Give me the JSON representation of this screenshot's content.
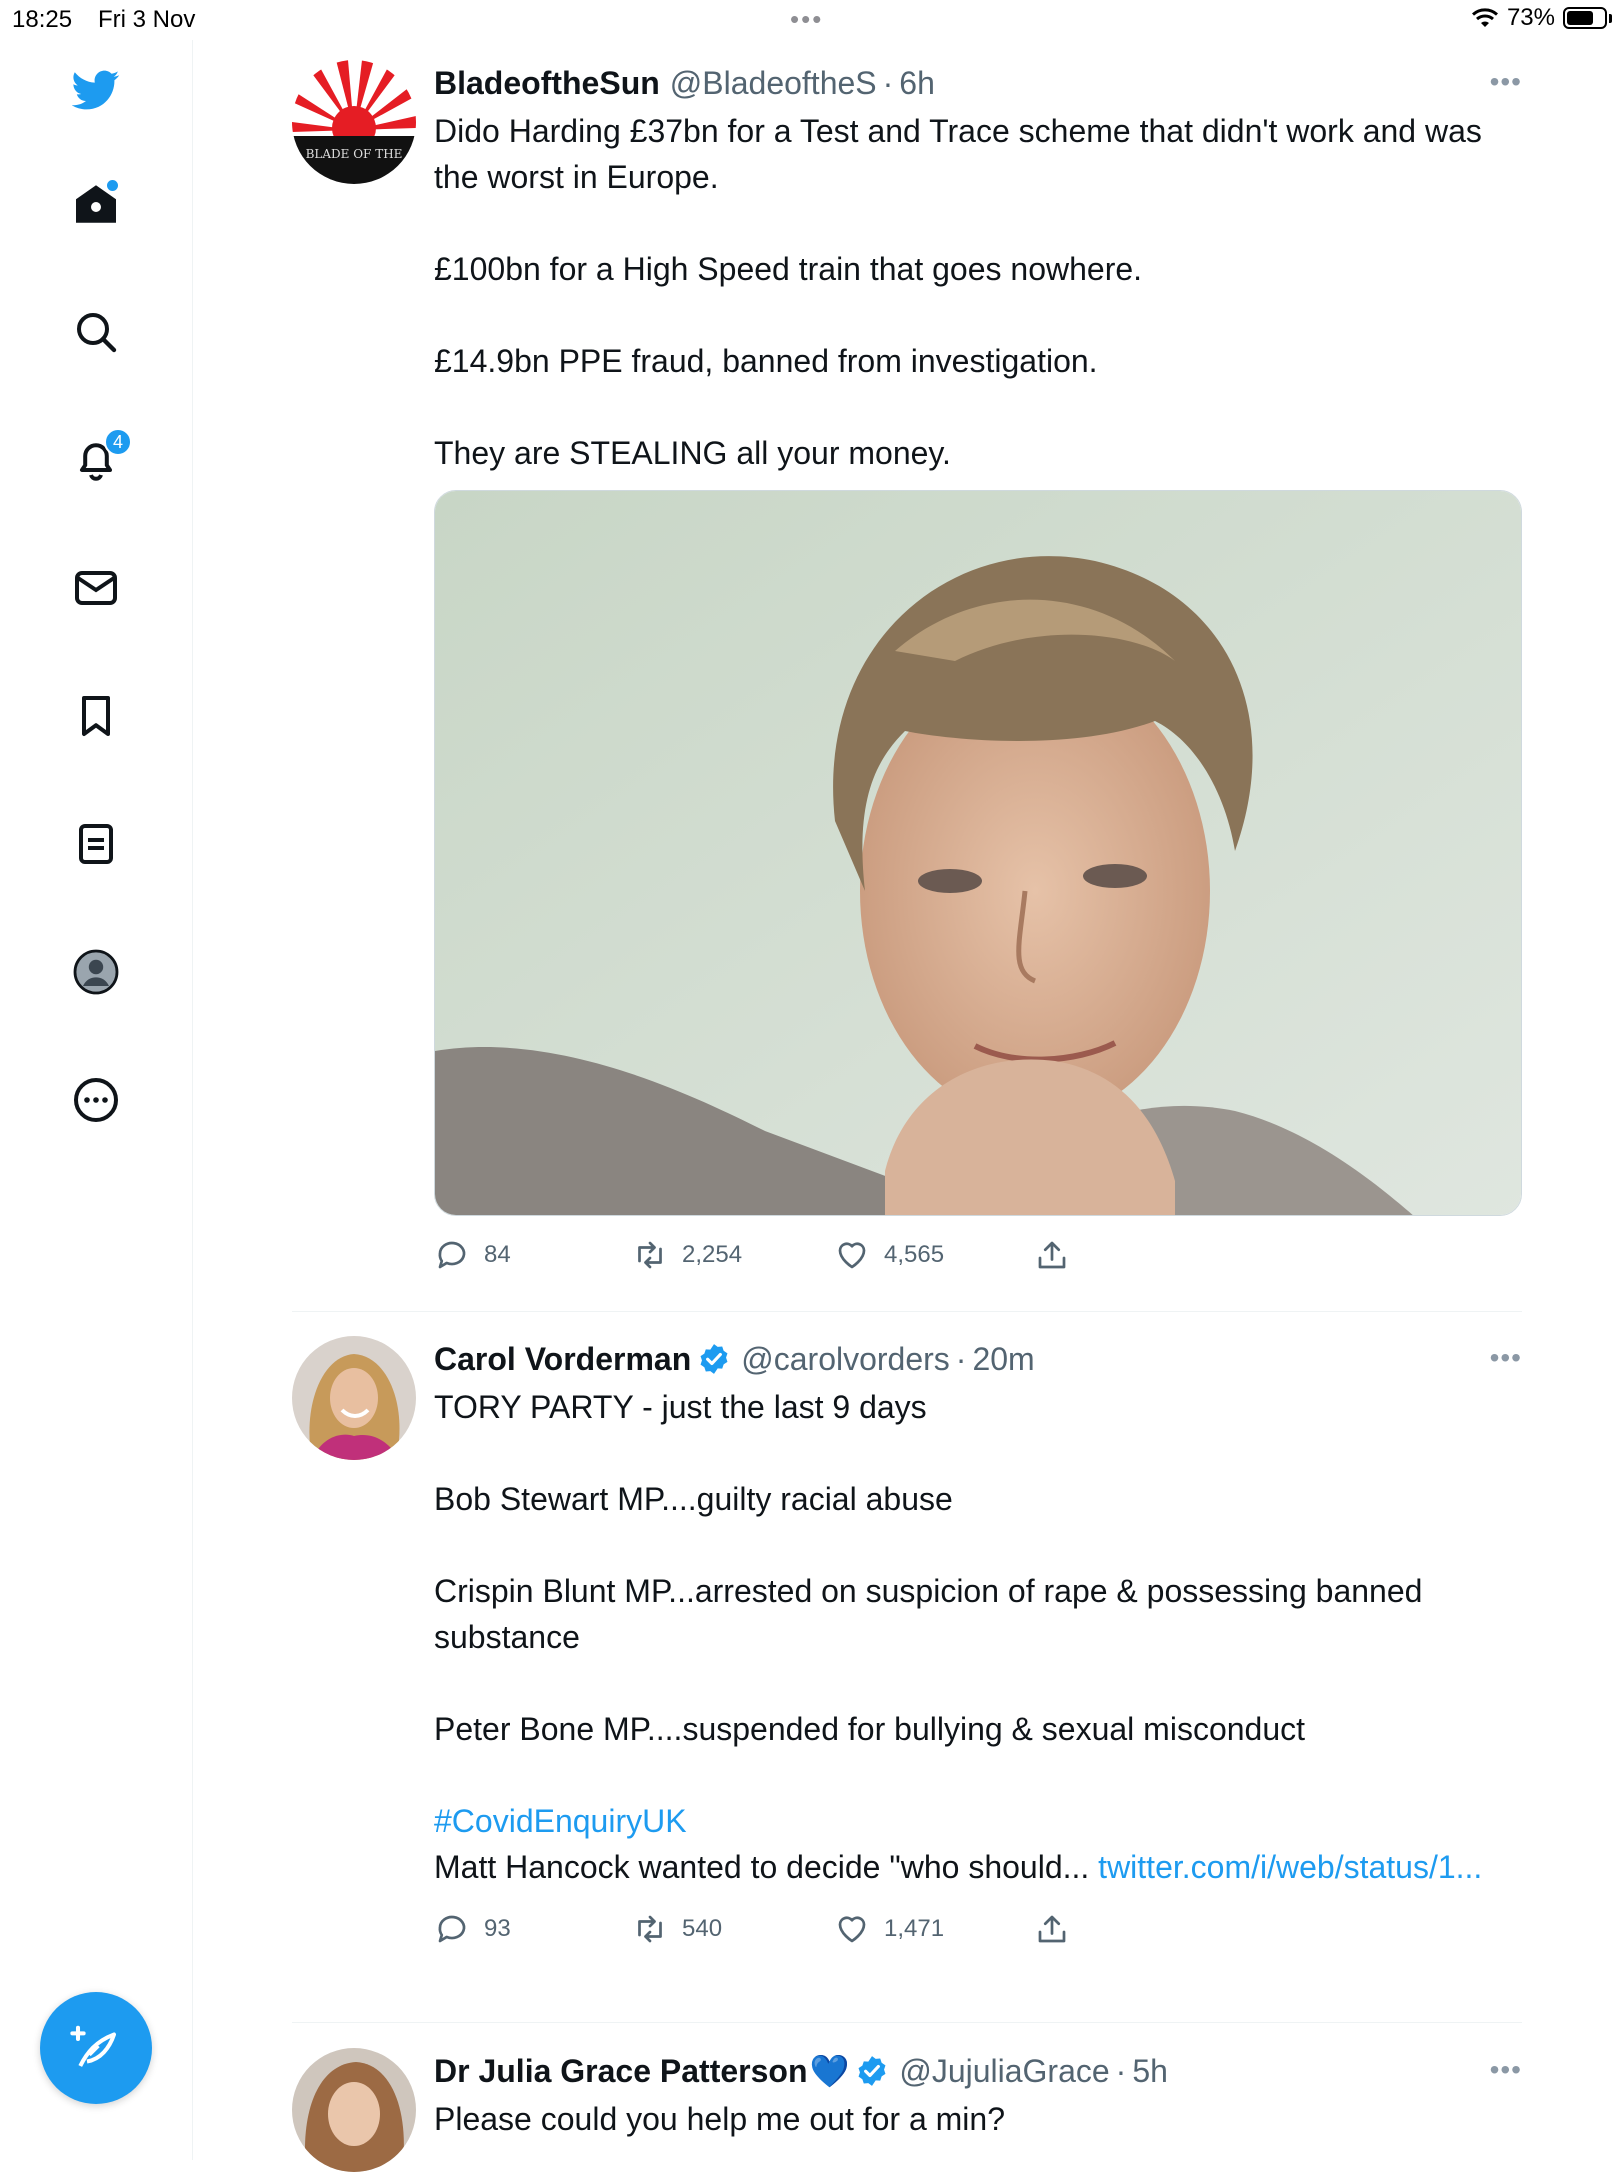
{
  "status_bar": {
    "time": "18:25",
    "date": "Fri 3 Nov",
    "battery": "73%",
    "battery_level": 0.73
  },
  "sidebar": {
    "notifications_badge": "4",
    "items": [
      "twitter-logo",
      "home-icon",
      "search-icon",
      "notifications-icon",
      "messages-icon",
      "bookmarks-icon",
      "lists-icon",
      "profile-icon",
      "more-icon"
    ]
  },
  "tweets": [
    {
      "name": "BladeoftheSun",
      "handle": "@BladeoftheS",
      "time": "6h",
      "avatar_text": "BLADE OF THE",
      "paragraphs": [
        "Dido Harding £37bn for a Test and Trace scheme that didn't work and was the worst in Europe.",
        "£100bn for a High Speed train that goes nowhere.",
        "£14.9bn PPE fraud, banned from investigation.",
        "They are STEALING all your money."
      ],
      "replies": "84",
      "retweets": "2,254",
      "likes": "4,565"
    },
    {
      "name": "Carol Vorderman",
      "handle": "@carolvorders",
      "time": "20m",
      "paragraphs": [
        "TORY PARTY - just the last 9 days",
        "Bob Stewart MP....guilty racial abuse",
        "Crispin Blunt MP...arrested on suspicion of rape & possessing banned substance",
        "Peter Bone MP....suspended for bullying & sexual misconduct"
      ],
      "hashtag": "#CovidEnquiryUK",
      "last_text": "Matt Hancock wanted to decide \"who should... ",
      "link": "twitter.com/i/web/status/1...",
      "replies": "93",
      "retweets": "540",
      "likes": "1,471"
    },
    {
      "name": "Dr Julia Grace Patterson",
      "name_emoji": "💙",
      "handle": "@JujuliaGrace",
      "time": "5h",
      "paragraphs": [
        "Please could you help me out for a min?"
      ]
    }
  ],
  "colors": {
    "accent": "#1d9bf0",
    "text": "#0f1419",
    "muted": "#536471",
    "verified": "#1d9bf0"
  }
}
